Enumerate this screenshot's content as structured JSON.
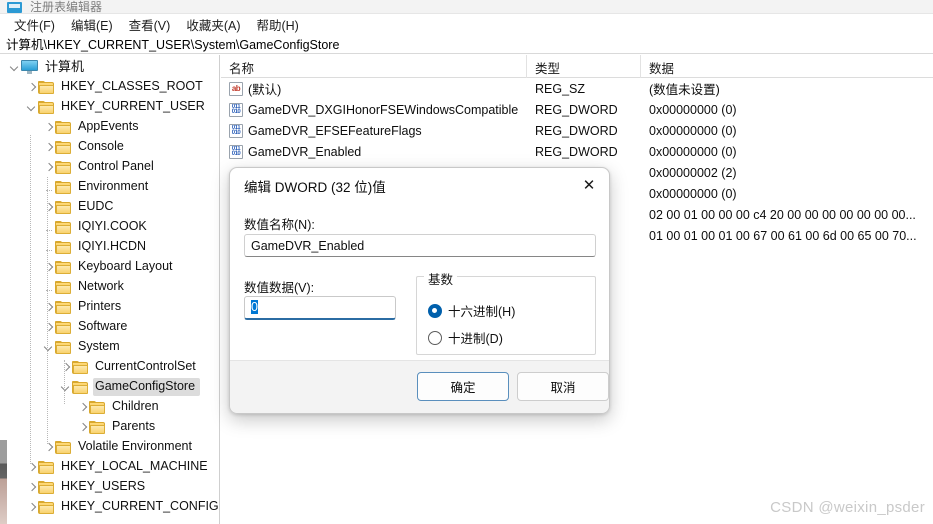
{
  "window": {
    "title": "注册表编辑器",
    "icon": "registry-editor-icon"
  },
  "menubar": {
    "items": [
      {
        "label": "文件(F)",
        "name": "menu-file"
      },
      {
        "label": "编辑(E)",
        "name": "menu-edit"
      },
      {
        "label": "查看(V)",
        "name": "menu-view"
      },
      {
        "label": "收藏夹(A)",
        "name": "menu-favorites"
      },
      {
        "label": "帮助(H)",
        "name": "menu-help"
      }
    ]
  },
  "address": {
    "path": "计算机\\HKEY_CURRENT_USER\\System\\GameConfigStore"
  },
  "tree": {
    "items": [
      {
        "label": "计算机",
        "indent": 0,
        "state": "open",
        "icon": "computer-icon",
        "selected": false
      },
      {
        "label": "HKEY_CLASSES_ROOT",
        "indent": 1,
        "state": "collapsed",
        "icon": "folder-icon",
        "selected": false
      },
      {
        "label": "HKEY_CURRENT_USER",
        "indent": 1,
        "state": "open",
        "icon": "folder-icon",
        "selected": false
      },
      {
        "label": "AppEvents",
        "indent": 2,
        "state": "collapsed",
        "icon": "folder-icon",
        "selected": false
      },
      {
        "label": "Console",
        "indent": 2,
        "state": "collapsed",
        "icon": "folder-icon",
        "selected": false
      },
      {
        "label": "Control Panel",
        "indent": 2,
        "state": "collapsed",
        "icon": "folder-icon",
        "selected": false
      },
      {
        "label": "Environment",
        "indent": 2,
        "state": "leaf",
        "icon": "folder-icon",
        "selected": false
      },
      {
        "label": "EUDC",
        "indent": 2,
        "state": "collapsed",
        "icon": "folder-icon",
        "selected": false
      },
      {
        "label": "IQIYI.COOK",
        "indent": 2,
        "state": "leaf",
        "icon": "folder-icon",
        "selected": false
      },
      {
        "label": "IQIYI.HCDN",
        "indent": 2,
        "state": "leaf",
        "icon": "folder-icon",
        "selected": false
      },
      {
        "label": "Keyboard Layout",
        "indent": 2,
        "state": "collapsed",
        "icon": "folder-icon",
        "selected": false
      },
      {
        "label": "Network",
        "indent": 2,
        "state": "leaf",
        "icon": "folder-icon",
        "selected": false
      },
      {
        "label": "Printers",
        "indent": 2,
        "state": "collapsed",
        "icon": "folder-icon",
        "selected": false
      },
      {
        "label": "Software",
        "indent": 2,
        "state": "collapsed",
        "icon": "folder-icon",
        "selected": false
      },
      {
        "label": "System",
        "indent": 2,
        "state": "open",
        "icon": "folder-icon",
        "selected": false
      },
      {
        "label": "CurrentControlSet",
        "indent": 3,
        "state": "collapsed",
        "icon": "folder-icon",
        "selected": false
      },
      {
        "label": "GameConfigStore",
        "indent": 3,
        "state": "open",
        "icon": "folder-icon",
        "selected": true
      },
      {
        "label": "Children",
        "indent": 4,
        "state": "collapsed",
        "icon": "folder-icon",
        "selected": false
      },
      {
        "label": "Parents",
        "indent": 4,
        "state": "collapsed",
        "icon": "folder-icon",
        "selected": false
      },
      {
        "label": "Volatile Environment",
        "indent": 2,
        "state": "collapsed",
        "icon": "folder-icon",
        "selected": false
      },
      {
        "label": "HKEY_LOCAL_MACHINE",
        "indent": 1,
        "state": "collapsed",
        "icon": "folder-icon",
        "selected": false
      },
      {
        "label": "HKEY_USERS",
        "indent": 1,
        "state": "collapsed",
        "icon": "folder-icon",
        "selected": false
      },
      {
        "label": "HKEY_CURRENT_CONFIG",
        "indent": 1,
        "state": "collapsed",
        "icon": "folder-icon",
        "selected": false
      }
    ]
  },
  "list": {
    "columns": [
      {
        "label": "名称",
        "name": "column-name"
      },
      {
        "label": "类型",
        "name": "column-type"
      },
      {
        "label": "数据",
        "name": "column-data"
      }
    ],
    "rows": [
      {
        "name": "(默认)",
        "type": "REG_SZ",
        "data": "(数值未设置)",
        "icon": "reg-sz-icon"
      },
      {
        "name": "GameDVR_DXGIHonorFSEWindowsCompatible",
        "type": "REG_DWORD",
        "data": "0x00000000 (0)",
        "icon": "reg-dword-icon"
      },
      {
        "name": "GameDVR_EFSEFeatureFlags",
        "type": "REG_DWORD",
        "data": "0x00000000 (0)",
        "icon": "reg-dword-icon"
      },
      {
        "name": "GameDVR_Enabled",
        "type": "REG_DWORD",
        "data": "0x00000000 (0)",
        "icon": "reg-dword-icon"
      },
      {
        "name": "",
        "type": "",
        "data": "0x00000002 (2)",
        "icon": ""
      },
      {
        "name": "",
        "type": "",
        "data": "0x00000000 (0)",
        "icon": ""
      },
      {
        "name": "",
        "type": "",
        "data": "02 00 01 00 00 00 c4 20 00 00 00 00 00 00 00...",
        "icon": ""
      },
      {
        "name": "",
        "type": "",
        "data": "01 00 01 00 01 00 67 00 61 00 6d 00 65 00 70...",
        "icon": ""
      }
    ]
  },
  "dialog": {
    "title": "编辑 DWORD (32 位)值",
    "close_label": "✕",
    "value_name_label": "数值名称(N):",
    "value_name": "GameDVR_Enabled",
    "value_data_label": "数值数据(V):",
    "value_data": "0",
    "radix": {
      "legend": "基数",
      "options": [
        {
          "label": "十六进制(H)",
          "selected": true,
          "name": "radio-hexadecimal"
        },
        {
          "label": "十进制(D)",
          "selected": false,
          "name": "radio-decimal"
        }
      ]
    },
    "ok_label": "确定",
    "cancel_label": "取消"
  },
  "watermark": {
    "text": "CSDN @weixin_psder"
  }
}
